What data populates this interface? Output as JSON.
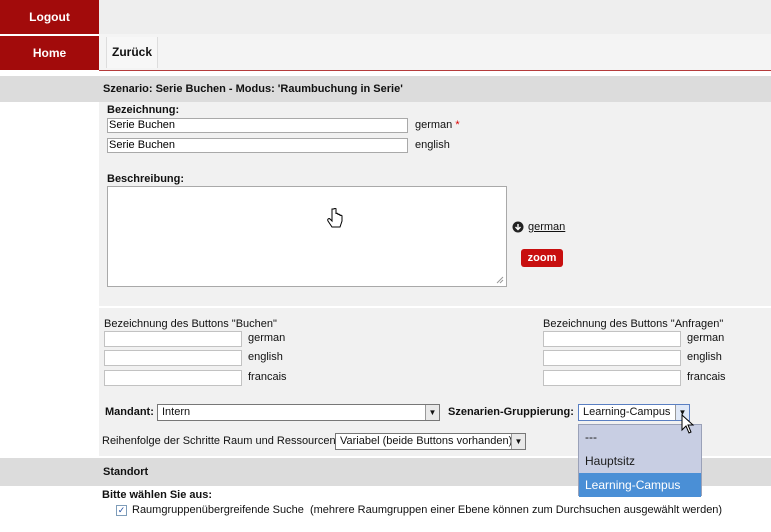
{
  "sidebar": {
    "logout": "Logout",
    "home": "Home"
  },
  "tabs": {
    "back": "Zurück"
  },
  "scenario_title": "Szenario: Serie Buchen - Modus: 'Raumbuchung in Serie'",
  "bezeichnung": {
    "label": "Bezeichnung:",
    "german_value": "Serie Buchen",
    "german_lang": "german",
    "required_mark": "*",
    "english_value": "Serie Buchen",
    "english_lang": "english"
  },
  "beschreibung": {
    "label": "Beschreibung:",
    "lang_link": "german",
    "zoom": "zoom"
  },
  "buttons_buchen": {
    "label": "Bezeichnung des Buttons \"Buchen\"",
    "langs": [
      "german",
      "english",
      "francais"
    ]
  },
  "buttons_anfragen": {
    "label": "Bezeichnung des Buttons \"Anfragen\"",
    "langs": [
      "german",
      "english",
      "francais"
    ]
  },
  "mandant": {
    "label": "Mandant:",
    "value": "Intern"
  },
  "gruppierung": {
    "label": "Szenarien-Gruppierung:",
    "value": "Learning-Campus",
    "options": [
      "---",
      "Hauptsitz",
      "Learning-Campus"
    ],
    "selected_index": 2
  },
  "reihenfolge": {
    "label": "Reihenfolge der Schritte Raum und Ressourcen:",
    "value": "Variabel (beide Buttons vorhanden)"
  },
  "standort": {
    "title": "Standort",
    "prompt": "Bitte wählen Sie aus:",
    "checkbox_label": "Raumgruppenübergreifende Suche",
    "checkbox_note": "(mehrere Raumgruppen einer Ebene können zum Durchsuchen ausgewählt werden)",
    "checked": true
  },
  "colors": {
    "sidebar": "#a20b0b",
    "zoom": "#c80f0f",
    "dropdown_active": "#4a8fd6"
  }
}
